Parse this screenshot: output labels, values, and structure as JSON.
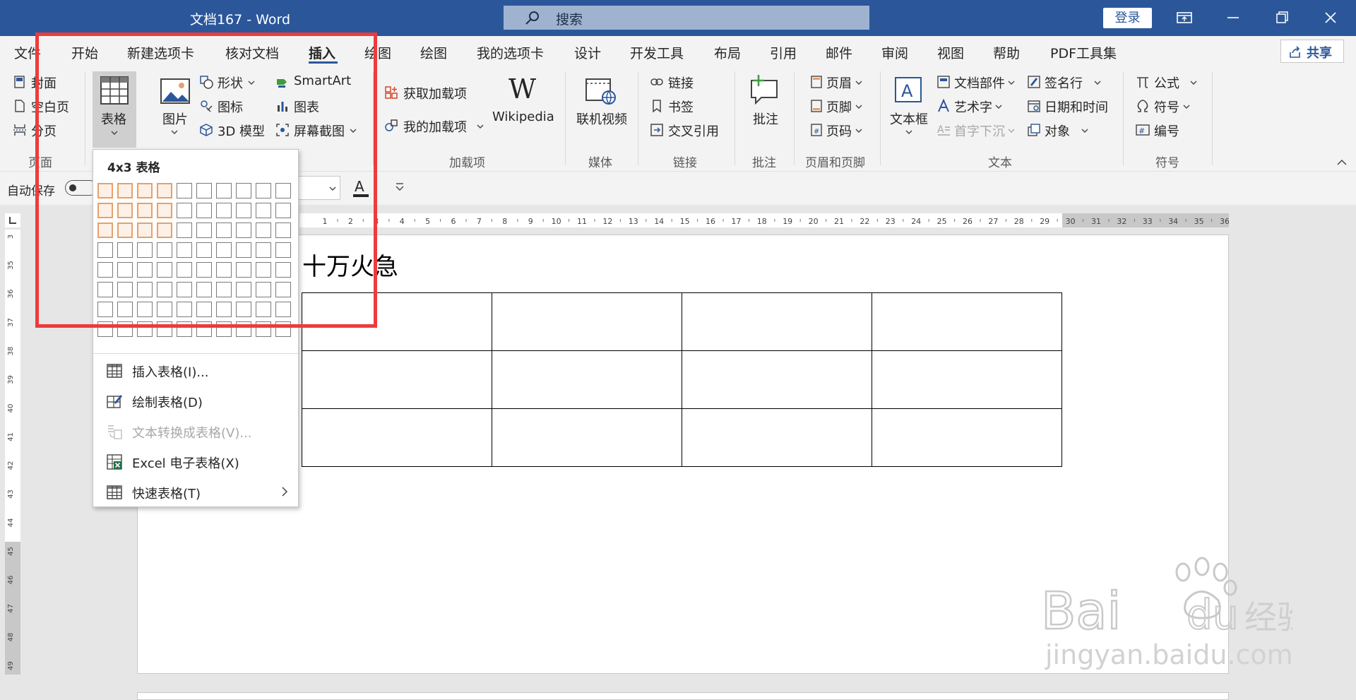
{
  "window": {
    "title": "文档167  -  Word",
    "search_placeholder": "搜索",
    "login_label": "登录"
  },
  "tabs": [
    "文件",
    "开始",
    "新建选项卡",
    "核对文档",
    "插入",
    "绘图",
    "绘图",
    "我的选项卡",
    "设计",
    "开发工具",
    "布局",
    "引用",
    "邮件",
    "审阅",
    "视图",
    "帮助",
    "PDF工具集"
  ],
  "active_tab": "插入",
  "share_label": "共享",
  "ribbon": {
    "page_group": {
      "items": [
        "封面",
        "空白页",
        "分页"
      ],
      "label": "页面"
    },
    "table_button": "表格",
    "pictures_button": "图片",
    "illustrations": {
      "col1": [
        "形状",
        "图标",
        "3D 模型"
      ],
      "col2": [
        "SmartArt",
        "图表",
        "屏幕截图"
      ]
    },
    "addins": {
      "items": [
        "获取加载项",
        "我的加载项"
      ],
      "wikipedia": "Wikipedia",
      "label": "加载项"
    },
    "media": {
      "button": "联机视频",
      "label": "媒体"
    },
    "links": {
      "items": [
        "链接",
        "书签",
        "交叉引用"
      ],
      "label": "链接"
    },
    "comments": {
      "button": "批注",
      "label": "批注"
    },
    "header_footer": {
      "items": [
        "页眉",
        "页脚",
        "页码"
      ],
      "label": "页眉和页脚"
    },
    "text": {
      "textbox": "文本框",
      "col1": [
        "文档部件",
        "艺术字",
        "首字下沉"
      ],
      "col2": [
        "签名行",
        "日期和时间",
        "对象"
      ],
      "label": "文本"
    },
    "symbols": {
      "items": [
        "公式",
        "符号",
        "编号"
      ],
      "label": "符号"
    }
  },
  "qat": {
    "autosave_label": "自动保存"
  },
  "ruler": {
    "h_ticks": [
      "1",
      "2",
      "3",
      "4",
      "5",
      "6",
      "7",
      "8",
      "9",
      "10",
      "11",
      "12",
      "13",
      "14",
      "15",
      "16",
      "17",
      "18",
      "19",
      "20",
      "21",
      "22",
      "23",
      "24",
      "25",
      "26",
      "27",
      "28",
      "29",
      "30",
      "31",
      "32",
      "33",
      "34",
      "35",
      "36"
    ],
    "v_ticks": [
      "3",
      "35",
      "36",
      "37",
      "38",
      "39",
      "40",
      "41",
      "42",
      "43",
      "44",
      "45",
      "46",
      "47",
      "48",
      "49"
    ]
  },
  "document": {
    "heading": "十万火急",
    "table": {
      "rows": 3,
      "cols": 4
    }
  },
  "table_dropdown": {
    "title": "4x3 表格",
    "grid": {
      "cols": 10,
      "rows": 8,
      "highlight_cols": 4,
      "highlight_rows": 3
    },
    "menu": [
      {
        "label": "插入表格(I)...",
        "icon": "table-icon",
        "disabled": false
      },
      {
        "label": "绘制表格(D)",
        "icon": "draw-table-icon",
        "disabled": false
      },
      {
        "label": "文本转换成表格(V)...",
        "icon": "convert-text-icon",
        "disabled": true
      },
      {
        "label": "Excel 电子表格(X)",
        "icon": "excel-icon",
        "disabled": false
      },
      {
        "label": "快速表格(T)",
        "icon": "quick-table-icon",
        "disabled": false,
        "submenu": true
      }
    ]
  },
  "watermark": {
    "brand": "Bai经验",
    "url": "jingyan.baidu.com"
  },
  "colors": {
    "accent": "#2b579a",
    "highlight_box": "#ee3b3b",
    "grid_highlight": "#e8a06a"
  }
}
